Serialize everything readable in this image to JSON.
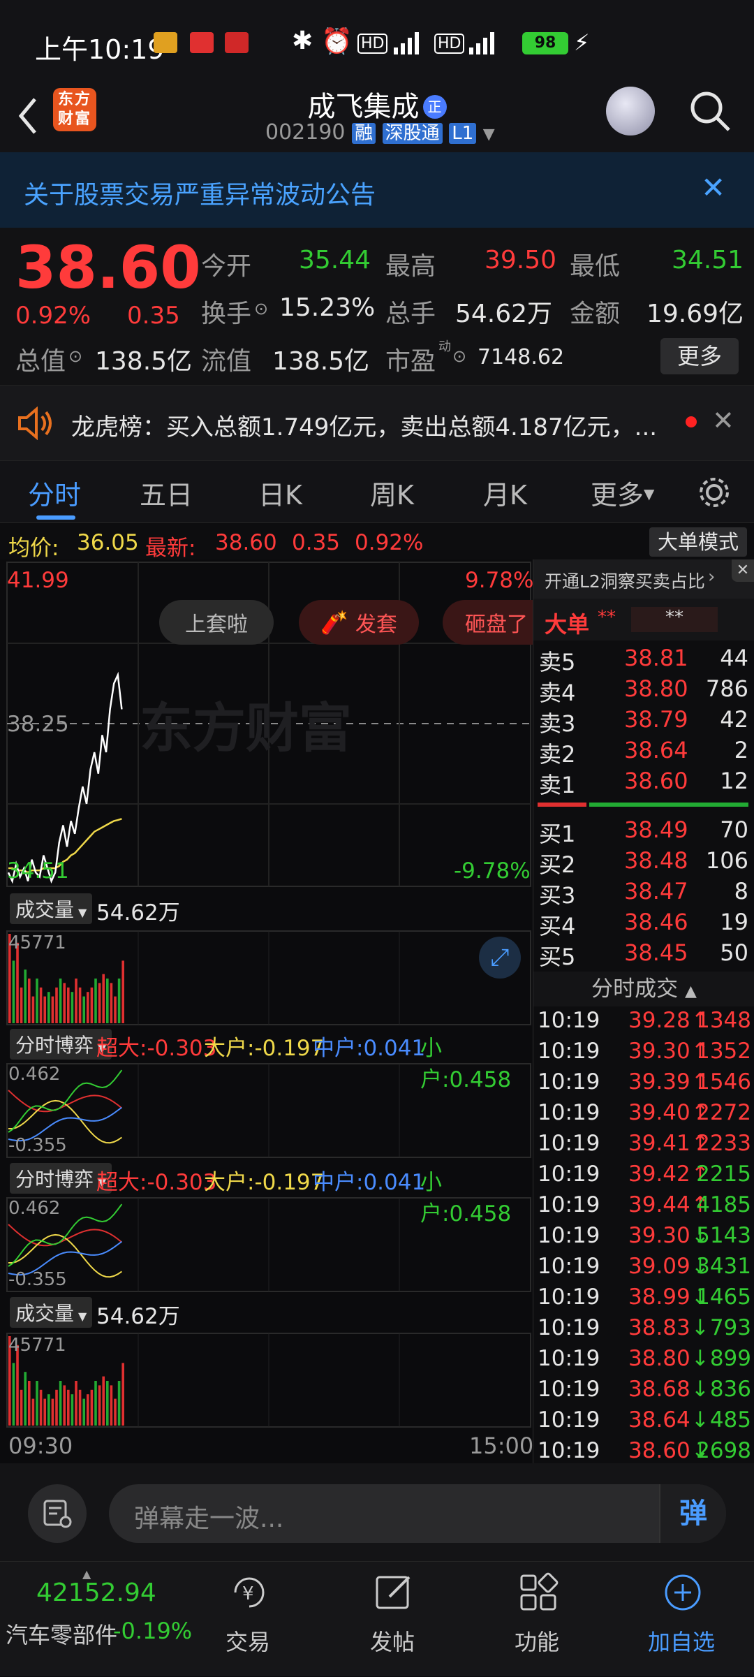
{
  "status_bar": {
    "time": "上午10:19",
    "battery": "98"
  },
  "header": {
    "logo_text": "东方财富",
    "stock_name": "成飞集成",
    "badge": "正",
    "stock_code": "002190",
    "tags": [
      "融",
      "深股通",
      "L1"
    ]
  },
  "notice": {
    "text": "关于股票交易严重异常波动公告"
  },
  "quote": {
    "price": "38.60",
    "change_pct": "0.92%",
    "change": "0.35",
    "open_label": "今开",
    "open": "35.44",
    "high_label": "最高",
    "high": "39.50",
    "low_label": "最低",
    "low": "34.51",
    "turnover_label": "换手",
    "turnover": "15.23%",
    "volume_label": "总手",
    "volume": "54.62万",
    "amount_label": "金额",
    "amount": "19.69亿",
    "mktcap_label": "总值",
    "mktcap": "138.5亿",
    "float_label": "流值",
    "float": "138.5亿",
    "pe_label": "市盈",
    "pe_super": "动",
    "pe": "7148.62",
    "more_button": "更多"
  },
  "dragon_tiger": {
    "text": "龙虎榜：买入总额1.749亿元，卖出总额4.187亿元，..."
  },
  "tabs": {
    "items": [
      "分时",
      "五日",
      "日K",
      "周K",
      "月K",
      "更多"
    ],
    "active": 0
  },
  "avg_bar": {
    "avg_label": "均价:",
    "avg_value": "36.05",
    "latest_label": "最新:",
    "latest_price": "38.60",
    "latest_change": "0.35",
    "latest_pct": "0.92%",
    "mode_button": "大单模式"
  },
  "chart": {
    "high_price": "41.99",
    "high_pct": "9.78%",
    "mid_price": "38.25",
    "low_price": "34.51",
    "low_pct": "-9.78%",
    "watermark": "东方财富",
    "emotion_buttons": [
      "上套啦",
      "发套",
      "砸盘了"
    ],
    "volume_label": "成交量",
    "volume_value": "54.62万",
    "volume_max": "45771",
    "game_label": "分时博弈",
    "super_large": "超大:-0.303",
    "large": "大户:-0.197",
    "medium": "中户:0.041",
    "small": "小户:0.458",
    "game_top": "0.462",
    "game_bottom": "-0.355",
    "time_start": "09:30",
    "time_end": "15:00",
    "price_series": [
      34.8,
      34.6,
      35.0,
      34.7,
      34.9,
      34.6,
      35.1,
      34.8,
      34.7,
      35.2,
      34.9,
      34.6,
      34.8,
      35.5,
      35.9,
      35.4,
      36.0,
      35.7,
      36.3,
      36.8,
      36.4,
      37.2,
      37.6,
      37.1,
      38.0,
      37.6,
      38.6,
      39.2,
      39.4,
      38.6
    ],
    "avg_series": [
      34.9,
      34.9,
      34.85,
      34.85,
      34.85,
      34.8,
      34.85,
      34.85,
      34.85,
      34.9,
      34.9,
      34.9,
      34.9,
      34.95,
      35.05,
      35.1,
      35.2,
      35.25,
      35.35,
      35.45,
      35.55,
      35.65,
      35.75,
      35.8,
      35.85,
      35.9,
      35.95,
      36.0,
      36.02,
      36.05
    ],
    "volume_series": [
      1.0,
      0.7,
      0.9,
      0.4,
      0.6,
      0.5,
      0.3,
      0.5,
      0.4,
      0.3,
      0.35,
      0.3,
      0.4,
      0.5,
      0.45,
      0.4,
      0.35,
      0.5,
      0.4,
      0.3,
      0.35,
      0.4,
      0.5,
      0.45,
      0.55,
      0.5,
      0.45,
      0.3,
      0.5,
      0.7
    ]
  },
  "order_book": {
    "l2_text": "开通L2洞察买卖占比",
    "big_order_label": "大单",
    "big_order_vals": [
      "**",
      "**"
    ],
    "asks": [
      {
        "label": "卖5",
        "price": "38.81",
        "vol": "44"
      },
      {
        "label": "卖4",
        "price": "38.80",
        "vol": "786"
      },
      {
        "label": "卖3",
        "price": "38.79",
        "vol": "42"
      },
      {
        "label": "卖2",
        "price": "38.64",
        "vol": "2"
      },
      {
        "label": "卖1",
        "price": "38.60",
        "vol": "12"
      }
    ],
    "bids": [
      {
        "label": "买1",
        "price": "38.49",
        "vol": "70"
      },
      {
        "label": "买2",
        "price": "38.48",
        "vol": "106"
      },
      {
        "label": "买3",
        "price": "38.47",
        "vol": "8"
      },
      {
        "label": "买4",
        "price": "38.46",
        "vol": "19"
      },
      {
        "label": "买5",
        "price": "38.45",
        "vol": "50"
      }
    ],
    "ticks_title": "分时成交",
    "ticks": [
      {
        "time": "10:19",
        "price": "39.28",
        "dir": "↑",
        "vol": "1348"
      },
      {
        "time": "10:19",
        "price": "39.30",
        "dir": "↑",
        "vol": "1352"
      },
      {
        "time": "10:19",
        "price": "39.39",
        "dir": "↑",
        "vol": "1546"
      },
      {
        "time": "10:19",
        "price": "39.40",
        "dir": "↑",
        "vol": "2272"
      },
      {
        "time": "10:19",
        "price": "39.41",
        "dir": "↑",
        "vol": "2233"
      },
      {
        "time": "10:19",
        "price": "39.42",
        "dir": "↑",
        "vol": "2215"
      },
      {
        "time": "10:19",
        "price": "39.44",
        "dir": "↑",
        "vol": "4185"
      },
      {
        "time": "10:19",
        "price": "39.30",
        "dir": "↓",
        "vol": "5143"
      },
      {
        "time": "10:19",
        "price": "39.09",
        "dir": "↓",
        "vol": "3431"
      },
      {
        "time": "10:19",
        "price": "38.99",
        "dir": "↓",
        "vol": "1465"
      },
      {
        "time": "10:19",
        "price": "38.83",
        "dir": "↓",
        "vol": "793"
      },
      {
        "time": "10:19",
        "price": "38.80",
        "dir": "↓",
        "vol": "899"
      },
      {
        "time": "10:19",
        "price": "38.68",
        "dir": "↓",
        "vol": "836"
      },
      {
        "time": "10:19",
        "price": "38.64",
        "dir": "↓",
        "vol": "485"
      },
      {
        "time": "10:19",
        "price": "38.60",
        "dir": "↓",
        "vol": "2698"
      }
    ]
  },
  "input_bar": {
    "placeholder": "弹幕走一波...",
    "danmu_button": "弹"
  },
  "bottom_nav": {
    "index_value": "42152.94",
    "sector_name": "汽车零部件",
    "sector_change": "-0.19%",
    "items": [
      "交易",
      "发帖",
      "功能",
      "加自选"
    ]
  }
}
